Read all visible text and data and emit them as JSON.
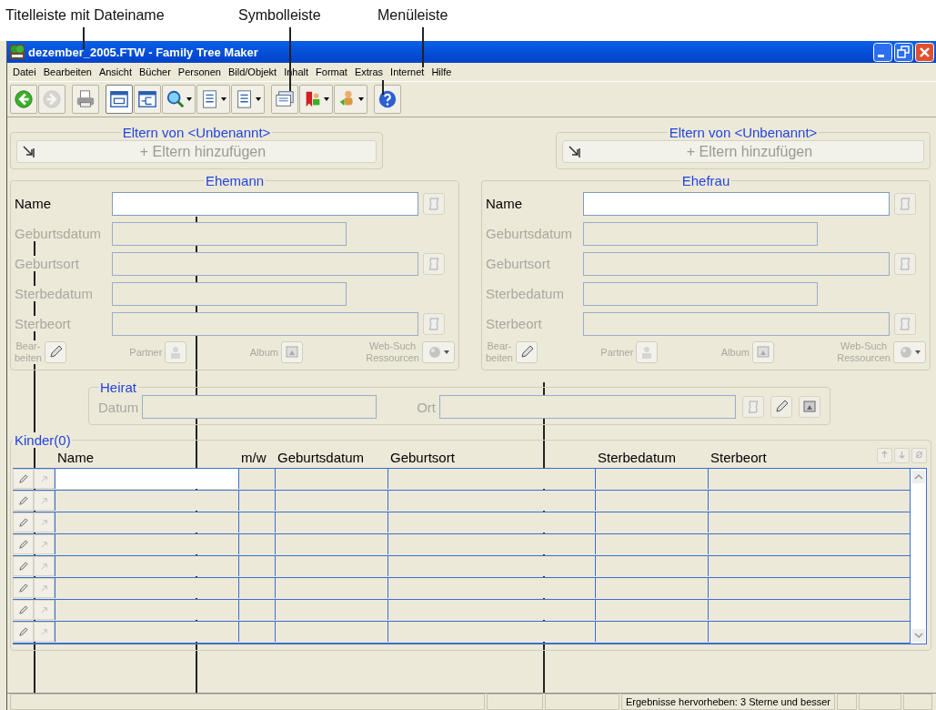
{
  "annotations": [
    {
      "label": "Titelleiste mit Dateiname"
    },
    {
      "label": "Symbolleiste"
    },
    {
      "label": "Menüleiste"
    }
  ],
  "window": {
    "title": "dezember_2005.FTW - Family Tree Maker"
  },
  "menu": [
    "Datei",
    "Bearbeiten",
    "Ansicht",
    "Bücher",
    "Personen",
    "Bild/Objekt",
    "Inhalt",
    "Format",
    "Extras",
    "Internet",
    "Hilfe"
  ],
  "toolbar": [
    {
      "kind": "back",
      "disabled": false,
      "selected": false
    },
    {
      "kind": "forward",
      "disabled": true,
      "selected": false
    },
    {
      "kind": "print",
      "disabled": false,
      "selected": false
    },
    {
      "kind": "family",
      "disabled": false,
      "selected": true
    },
    {
      "kind": "pedigree",
      "disabled": false,
      "selected": false
    },
    {
      "kind": "search",
      "disabled": false,
      "selected": false
    },
    {
      "kind": "tree",
      "disabled": false,
      "selected": false
    },
    {
      "kind": "report",
      "disabled": false,
      "selected": false
    },
    {
      "kind": "cards",
      "disabled": false,
      "selected": false
    },
    {
      "kind": "bookmark",
      "disabled": false,
      "selected": false
    },
    {
      "kind": "person",
      "disabled": false,
      "selected": false
    },
    {
      "kind": "help",
      "disabled": false,
      "selected": false
    }
  ],
  "parents": [
    {
      "title": "Eltern von  <Unbenannt>",
      "button": "+ Eltern hinzufügen"
    },
    {
      "title": "Eltern von  <Unbenannt>",
      "button": "+ Eltern hinzufügen"
    }
  ],
  "spouses": [
    {
      "title": "Ehemann",
      "fields": [
        {
          "label": "Name",
          "kind": "name",
          "disabled": false
        },
        {
          "label": "Geburtsdatum",
          "kind": "date",
          "disabled": true
        },
        {
          "label": "Geburtsort",
          "kind": "place",
          "disabled": true
        },
        {
          "label": "Sterbedatum",
          "kind": "date",
          "disabled": true
        },
        {
          "label": "Sterbeort",
          "kind": "place",
          "disabled": true
        }
      ],
      "actions": [
        {
          "kind": "edit",
          "lines": [
            "Bear-",
            "beiten"
          ],
          "disabled": false
        },
        {
          "kind": "partner",
          "lines": [
            "Partner"
          ],
          "disabled": true
        },
        {
          "kind": "album",
          "lines": [
            "Album"
          ],
          "disabled": true
        },
        {
          "kind": "web",
          "lines": [
            "Web-Such",
            "Ressourcen"
          ],
          "disabled": true
        }
      ]
    },
    {
      "title": "Ehefrau",
      "fields": [
        {
          "label": "Name",
          "kind": "name",
          "disabled": false
        },
        {
          "label": "Geburtsdatum",
          "kind": "date",
          "disabled": true
        },
        {
          "label": "Geburtsort",
          "kind": "place",
          "disabled": true
        },
        {
          "label": "Sterbedatum",
          "kind": "date",
          "disabled": true
        },
        {
          "label": "Sterbeort",
          "kind": "place",
          "disabled": true
        }
      ],
      "actions": [
        {
          "kind": "edit",
          "lines": [
            "Bear-",
            "beiten"
          ],
          "disabled": false
        },
        {
          "kind": "partner",
          "lines": [
            "Partner"
          ],
          "disabled": true
        },
        {
          "kind": "album",
          "lines": [
            "Album"
          ],
          "disabled": true
        },
        {
          "kind": "web",
          "lines": [
            "Web-Such",
            "Ressourcen"
          ],
          "disabled": true
        }
      ]
    }
  ],
  "marriage": {
    "title": "Heirat",
    "date_label": "Datum",
    "place_label": "Ort"
  },
  "children": {
    "title": "Kinder(0)",
    "columns": [
      "Name",
      "m/w",
      "Geburtsdatum",
      "Geburtsort",
      "Sterbedatum",
      "Sterbeort"
    ],
    "rows": [
      {
        "selected": true
      },
      {
        "selected": false
      },
      {
        "selected": false
      },
      {
        "selected": false
      },
      {
        "selected": false
      },
      {
        "selected": false
      },
      {
        "selected": false
      },
      {
        "selected": false
      }
    ]
  },
  "status_bar": {
    "filter": "Ergebnisse hervorheben: 3 Sterne und besser"
  }
}
